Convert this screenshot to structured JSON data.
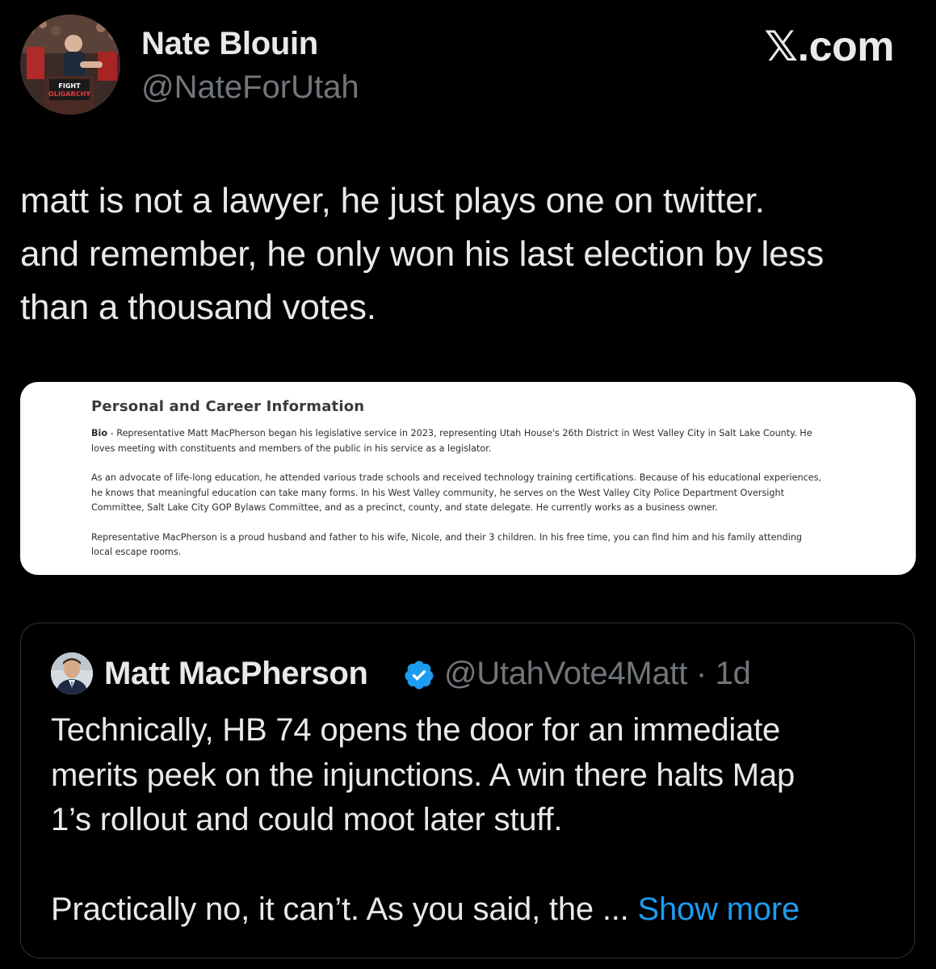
{
  "site": {
    "brand_letter": "𝕏",
    "brand_suffix": ".com"
  },
  "tweet": {
    "author_name": "Nate Blouin",
    "author_handle": "@NateForUtah",
    "avatar_sign_text": [
      "FIGHT",
      "OLIGARCHY"
    ],
    "text_lines": [
      "matt is not a lawyer, he just plays one on twitter.",
      "and remember, he only won his last election by less",
      "than a thousand votes."
    ]
  },
  "media": {
    "heading": "Personal and Career Information",
    "bio_label": "Bio",
    "bio_lines": [
      " - Representative Matt MacPherson began his legislative service in 2023, representing Utah House's 26th District in West Valley City in Salt Lake County. He",
      "loves meeting with constituents and members of the public in his service as a legislator."
    ],
    "paragraph2_lines": [
      "As an advocate of life-long education, he attended various trade schools and received technology training certifications. Because of his educational experiences,",
      "he knows that meaningful education can take many forms. In his West Valley community, he serves on the West Valley City Police Department Oversight",
      "Committee, Salt Lake City GOP Bylaws Committee, and as a precinct, county, and state delegate. He currently works as a business owner."
    ],
    "paragraph3_lines": [
      "Representative MacPherson is a proud husband and father to his wife, Nicole, and their 3 children. In his free time, you can find him and his family attending",
      "local escape rooms."
    ]
  },
  "quoted_tweet": {
    "author_name": "Matt MacPherson",
    "author_handle_time": "@UtahVote4Matt · 1d",
    "text_lines": [
      "Technically, HB 74 opens the door for an immediate",
      "merits peek on the injunctions. A win there halts Map",
      "1’s rollout and could moot later stuff."
    ],
    "truncated_line": "Practically no, it can’t. As you said, the ... ",
    "show_more_label": "Show more"
  },
  "colors": {
    "background": "#000000",
    "primary_text": "#e7e9ea",
    "secondary_text": "#71767b",
    "link_blue": "#1d9bf0",
    "border": "#2f3336"
  }
}
